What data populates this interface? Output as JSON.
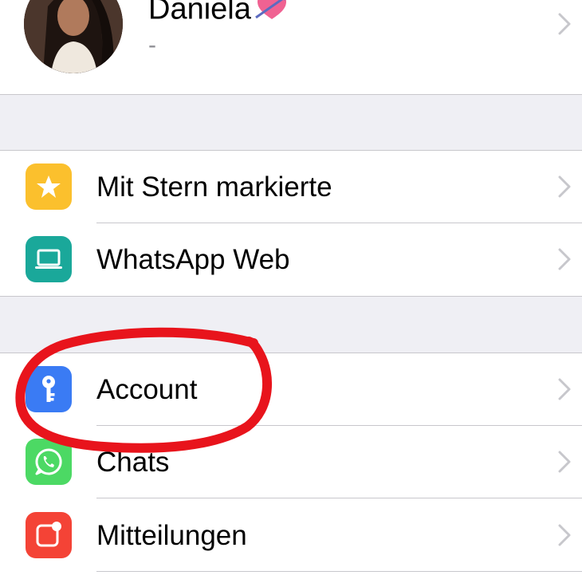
{
  "profile": {
    "name": "Daniela",
    "emoji_icon": "heart-arrow-icon",
    "status": "-"
  },
  "sections": [
    {
      "rows": [
        {
          "label": "Mit Stern markierte",
          "icon": "star-icon",
          "icon_bg": "#fbc02d"
        },
        {
          "label": "WhatsApp Web",
          "icon": "laptop-icon",
          "icon_bg": "#1aa89a"
        }
      ]
    },
    {
      "rows": [
        {
          "label": "Account",
          "icon": "key-icon",
          "icon_bg": "#3a7bf4"
        },
        {
          "label": "Chats",
          "icon": "whatsapp-icon",
          "icon_bg": "#4cd964"
        },
        {
          "label": "Mitteilungen",
          "icon": "notification-icon",
          "icon_bg": "#f44336"
        }
      ]
    }
  ],
  "colors": {
    "annotation": "#e8141c",
    "separator": "#c8c7cc",
    "group_background": "#efeff4",
    "chevron": "#c7c7cc"
  }
}
